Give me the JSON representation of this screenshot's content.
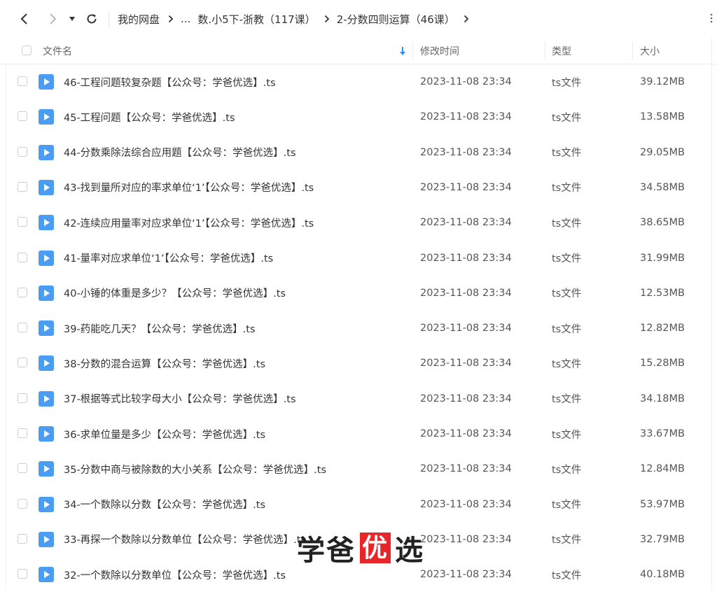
{
  "toolbar": {
    "breadcrumb": [
      "我的网盘",
      "...",
      "数.小5下-浙教（117课）",
      "2-分数四则运算（46课）"
    ]
  },
  "columns": {
    "name": "文件名",
    "modified": "修改时间",
    "type": "类型",
    "size": "大小"
  },
  "files": [
    {
      "name": "46-工程问题较复杂题【公众号：学爸优选】.ts",
      "modified": "2023-11-08 23:34",
      "type": "ts文件",
      "size": "39.12MB"
    },
    {
      "name": "45-工程问题【公众号：学爸优选】.ts",
      "modified": "2023-11-08 23:34",
      "type": "ts文件",
      "size": "13.58MB"
    },
    {
      "name": "44-分数乘除法综合应用题【公众号：学爸优选】.ts",
      "modified": "2023-11-08 23:34",
      "type": "ts文件",
      "size": "29.05MB"
    },
    {
      "name": "43-找到量所对应的率求单位‘1’【公众号：学爸优选】.ts",
      "modified": "2023-11-08 23:34",
      "type": "ts文件",
      "size": "34.58MB"
    },
    {
      "name": "42-连续应用量率对应求单位‘1’【公众号：学爸优选】.ts",
      "modified": "2023-11-08 23:34",
      "type": "ts文件",
      "size": "38.65MB"
    },
    {
      "name": "41-量率对应求单位‘1’【公众号：学爸优选】.ts",
      "modified": "2023-11-08 23:34",
      "type": "ts文件",
      "size": "31.99MB"
    },
    {
      "name": "40-小锤的体重是多少？【公众号：学爸优选】.ts",
      "modified": "2023-11-08 23:34",
      "type": "ts文件",
      "size": "12.53MB"
    },
    {
      "name": "39-药能吃几天？【公众号：学爸优选】.ts",
      "modified": "2023-11-08 23:34",
      "type": "ts文件",
      "size": "12.82MB"
    },
    {
      "name": "38-分数的混合运算【公众号：学爸优选】.ts",
      "modified": "2023-11-08 23:34",
      "type": "ts文件",
      "size": "15.28MB"
    },
    {
      "name": "37-根据等式比较字母大小【公众号：学爸优选】.ts",
      "modified": "2023-11-08 23:34",
      "type": "ts文件",
      "size": "34.18MB"
    },
    {
      "name": "36-求单位量是多少【公众号：学爸优选】.ts",
      "modified": "2023-11-08 23:34",
      "type": "ts文件",
      "size": "33.67MB"
    },
    {
      "name": "35-分数中商与被除数的大小关系【公众号：学爸优选】.ts",
      "modified": "2023-11-08 23:34",
      "type": "ts文件",
      "size": "12.84MB"
    },
    {
      "name": "34-一个数除以分数【公众号：学爸优选】.ts",
      "modified": "2023-11-08 23:34",
      "type": "ts文件",
      "size": "53.97MB"
    },
    {
      "name": "33-再探一个数除以分数单位【公众号：学爸优选】.ts",
      "modified": "2023-11-08 23:34",
      "type": "ts文件",
      "size": "32.79MB"
    },
    {
      "name": "32-一个数除以分数单位【公众号：学爸优选】.ts",
      "modified": "2023-11-08 23:34",
      "type": "ts文件",
      "size": "40.18MB"
    }
  ],
  "watermark": {
    "left": "学爸",
    "box": "优",
    "right": "选"
  },
  "colors": {
    "accent": "#2f8ff0",
    "file_icon": "#4a9df3",
    "watermark_box": "#e8262a"
  }
}
